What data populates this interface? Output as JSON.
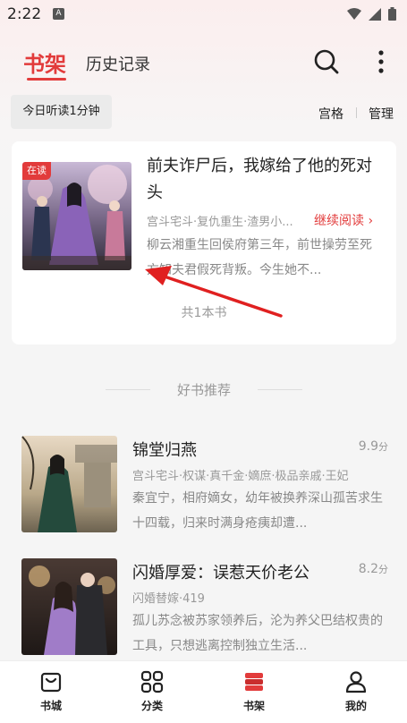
{
  "status_bar": {
    "time": "2:22",
    "app_icon": "A"
  },
  "header": {
    "tabs": [
      {
        "label": "书架",
        "active": true
      },
      {
        "label": "历史记录",
        "active": false
      }
    ],
    "icons": [
      "search-icon",
      "more-vertical-icon"
    ]
  },
  "toolbar": {
    "listen_time": "今日听读1分钟",
    "view_grid": "宫格",
    "manage": "管理"
  },
  "shelf": {
    "book": {
      "badge": "在读",
      "title": "前夫诈尸后，我嫁给了他的死对头",
      "meta": "宫斗宅斗·复仇重生·渣男小...",
      "continue": "继续阅读",
      "description": "柳云湘重生回侯府第三年，前世操劳至死方知夫君假死背叛。今生她不..."
    },
    "count": "共1本书"
  },
  "recommend": {
    "title": "好书推荐",
    "items": [
      {
        "title": "锦堂归燕",
        "score": "9.9",
        "score_unit": "分",
        "meta": "宫斗宅斗·权谋·真千金·嫡庶·极品亲戚·王妃",
        "description": "秦宜宁，相府嫡女，幼年被换养深山孤苦求生十四载，归来时满身疮痍却遭..."
      },
      {
        "title": "闪婚厚爱：误惹天价老公",
        "score": "8.2",
        "score_unit": "分",
        "meta": "闪婚替嫁·419",
        "description": "孤儿苏念被苏家领养后，沦为养父巴结权贵的工具，只想逃离控制独立生活..."
      }
    ]
  },
  "bottom_nav": [
    {
      "label": "书城",
      "icon": "store-bag-icon",
      "active": false
    },
    {
      "label": "分类",
      "icon": "category-grid-icon",
      "active": false
    },
    {
      "label": "书架",
      "icon": "bookshelf-icon",
      "active": true
    },
    {
      "label": "我的",
      "icon": "profile-icon",
      "active": false
    }
  ],
  "colors": {
    "accent": "#e23b3b",
    "text": "#222222",
    "muted": "#999999"
  }
}
